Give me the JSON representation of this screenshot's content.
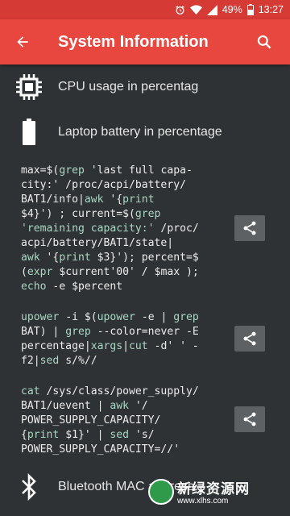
{
  "statusbar": {
    "battery": "49%",
    "time": "13:27"
  },
  "appbar": {
    "title": "System Information"
  },
  "rows": [
    {
      "label": "CPU usage in percentag"
    },
    {
      "label": "Laptop battery in percentage"
    },
    {
      "label": "Bluetooth MAC address"
    }
  ],
  "code_blocks": [
    {
      "lines": [
        [
          "max=$(",
          {
            "c": "grep"
          },
          " 'last full capa-"
        ],
        [
          "city:' /proc/acpi/battery/"
        ],
        [
          "BAT1/info|",
          {
            "c": "awk"
          },
          " '{",
          {
            "c": "print"
          }
        ],
        [
          "$4}') ; current=$(",
          {
            "c": "grep"
          }
        ],
        [
          {
            "c": "'remaining capacity:'"
          },
          " /proc/"
        ],
        [
          "acpi/battery/BAT1/state|"
        ],
        [
          {
            "c": "awk"
          },
          " '{",
          {
            "c": "print"
          },
          " $3}'); percent=$"
        ],
        [
          "(",
          {
            "c": "expr"
          },
          " $current'00' / $max );"
        ],
        [
          {
            "c": "echo"
          },
          " -e $percent"
        ]
      ]
    },
    {
      "lines": [
        [
          {
            "c": "upower"
          },
          " -i $(",
          {
            "c": "upower"
          },
          " -e | ",
          {
            "c": "grep"
          }
        ],
        [
          "BAT) | ",
          {
            "c": "grep"
          },
          " --color=never -E"
        ],
        [
          "percentage|",
          {
            "c": "xargs"
          },
          "|",
          {
            "c": "cut"
          },
          " -d' ' -"
        ],
        [
          "f2|",
          {
            "c": "sed"
          },
          " s/%//"
        ]
      ]
    },
    {
      "lines": [
        [
          {
            "c": "cat"
          },
          " /sys/class/power_supply/"
        ],
        [
          "BAT1/uevent | ",
          {
            "c": "awk"
          },
          " '/"
        ],
        [
          "POWER_SUPPLY_CAPACITY/"
        ],
        [
          "{",
          {
            "c": "print"
          },
          " $1}' | ",
          {
            "c": "sed"
          },
          " 's/"
        ],
        [
          "POWER_SUPPLY_CAPACITY=//'"
        ]
      ]
    }
  ],
  "watermark": {
    "title": "新绿资源网",
    "url": "www.xlhs.com"
  }
}
